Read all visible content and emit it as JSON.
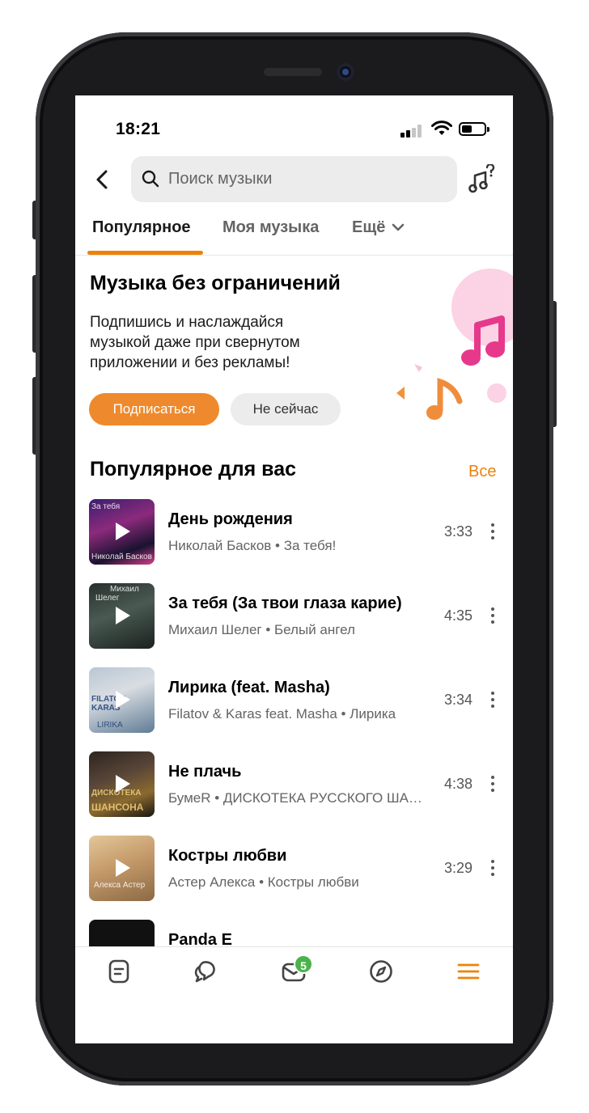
{
  "status_bar": {
    "time": "18:21"
  },
  "search": {
    "placeholder": "Поиск музыки"
  },
  "tabs": [
    {
      "label": "Популярное",
      "active": true
    },
    {
      "label": "Моя музыка",
      "active": false
    },
    {
      "label": "Ещё",
      "active": false
    }
  ],
  "promo": {
    "title": "Музыка без ограничений",
    "text_lines": [
      "Подпишись и наслаждайся",
      "музыкой даже при свернутом",
      "приложении и без рекламы!"
    ],
    "subscribe_label": "Подписаться",
    "later_label": "Не сейчас"
  },
  "section": {
    "title": "Популярное для вас",
    "all_label": "Все"
  },
  "tracks": [
    {
      "title": "День рождения",
      "subtitle": "Николай Басков • За тебя!",
      "duration": "3:33",
      "cover_text": [
        "За тебя",
        "Николай Басков"
      ]
    },
    {
      "title": "За тебя (За твои глаза карие)",
      "subtitle": "Михаил Шелег • Белый ангел",
      "duration": "4:35",
      "cover_text": [
        "Михаил",
        "Шелег"
      ]
    },
    {
      "title": "Лирика (feat. Masha)",
      "subtitle": "Filatov & Karas feat. Masha • Лирика",
      "duration": "3:34",
      "cover_text": [
        "FILATOV",
        "KARAS",
        "LIRIKA"
      ]
    },
    {
      "title": "Не плачь",
      "subtitle": "БумеR • ДИСКОТЕКА РУССКОГО ШАНСОНА",
      "duration": "4:38",
      "cover_text": [
        "ДИСКОТЕКА",
        "ШАНСОНА"
      ]
    },
    {
      "title": "Костры любви",
      "subtitle": "Астер Алекса • Костры любви",
      "duration": "3:29",
      "cover_text": [
        "Алекса Астер"
      ]
    },
    {
      "title": "Panda E",
      "subtitle": "",
      "duration": "",
      "cover_text": []
    }
  ],
  "bottom_nav": {
    "items": [
      "feed-icon",
      "chats-icon",
      "messages-icon",
      "discover-icon",
      "menu-icon"
    ],
    "messages_badge": "5",
    "active_color": "#ee8208"
  },
  "colors": {
    "accent": "#ee8208",
    "subscribe_button": "#ee8a2d",
    "badge": "#4bb34b"
  }
}
